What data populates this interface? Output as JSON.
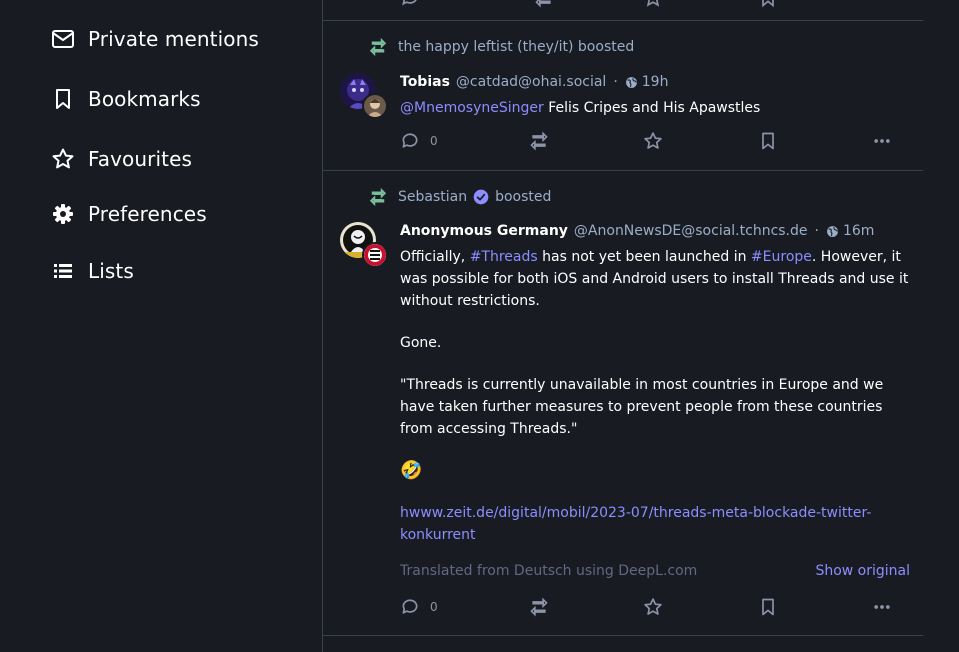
{
  "sidebar": {
    "items": [
      {
        "label": "Private mentions",
        "icon": "envelope-icon"
      },
      {
        "label": "Bookmarks",
        "icon": "bookmark-icon"
      },
      {
        "label": "Favourites",
        "icon": "star-icon"
      },
      {
        "label": "Preferences",
        "icon": "gear-icon"
      },
      {
        "label": "Lists",
        "icon": "list-icon"
      }
    ]
  },
  "posts": [
    {
      "boosted_by": "the happy leftist (they/it)",
      "boosted_suffix": "boosted",
      "display_name": "Tobias",
      "acct": "@catdad@ohai.social",
      "separator": "·",
      "time": "19h",
      "mention": "@MnemosyneSinger",
      "text": " Felis Cripes and His Apawstles",
      "replies": "0"
    },
    {
      "boosted_by": "Sebastian",
      "boosted_suffix": "boosted",
      "display_name": "Anonymous Germany",
      "acct": "@AnonNewsDE@social.tchncs.de",
      "separator": "·",
      "time": "16m",
      "p1_a": "Officially, ",
      "p1_tag1": "#Threads",
      "p1_b": " has not yet been launched in ",
      "p1_tag2": "#Europe",
      "p1_c": ". However, it was possible for both iOS and Android users to install Threads and use it without restrictions.",
      "p2": "Gone.",
      "p3": "\"Threads is currently unavailable in most countries in Europe and we have taken further measures to prevent people from these countries from accessing Threads.\"",
      "p4": "🤣",
      "link": "hwww.zeit.de/digital/mobil/2023-07/threads-meta-blockade-twitter-konkurrent",
      "translated": "Translated from Deutsch using DeepL.com",
      "show_original": "Show original",
      "replies": "0"
    }
  ],
  "colors": {
    "background": "#191b22",
    "border": "#393f4f",
    "muted": "#9baec8",
    "link": "#8c8dff",
    "boost_icon": "#79bd9a",
    "verified": "#8c8dff"
  }
}
